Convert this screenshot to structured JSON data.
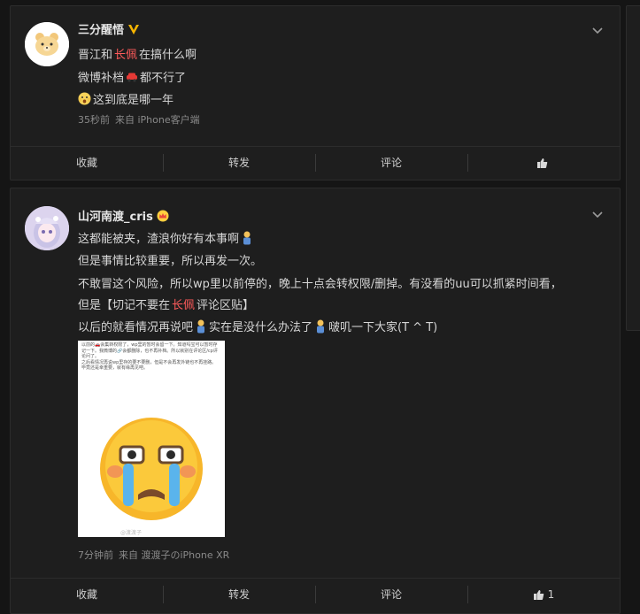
{
  "posts": [
    {
      "username": "三分醒悟",
      "badge": "verified-v-icon",
      "lines": {
        "l1_a": "晋江和",
        "l1_hl": "长佩",
        "l1_b": "在搞什么啊",
        "l2_a": "微博补档",
        "l2_b": "都不行了",
        "l3": "这到底是哪一年"
      },
      "meta": {
        "time": "35秒前",
        "source": "来自 iPhone客户端"
      },
      "actions": {
        "favorite": "收藏",
        "repost": "转发",
        "comment": "评论",
        "like": ""
      }
    },
    {
      "username": "山河南渡_cris",
      "badge": "crown-icon",
      "lines": {
        "l1": "这都能被夹，渣浪你好有本事啊",
        "l2": "但是事情比较重要，所以再发一次。",
        "l3": "不敢冒这个风险，所以wp里以前停的，晚上十点会转权限/删掉。有没看的uu可以抓紧时间看，",
        "l4_a": "但是【切记不要在",
        "l4_hl": "长佩",
        "l4_b": "评论区贴】",
        "l5_a": "以后的就看情况再说吧",
        "l5_b": "实在是没什么办法了",
        "l5_c": "啵叽一下大家(T ^ T)"
      },
      "image_text": {
        "p1": "以前的🚗会集转权限了，wp里的暂时会留一下。知道吗宝可以暂时存记一下。我微博的🔗会都删除，也不再补档。所以就别在评论区/cp评论问了。",
        "p2": "之后看情况再说wp里存的要不要删，但是不会再发外链也不再挂路。",
        "p3": "毕竟还是幸重要，就有缘再见吧。",
        "watermark": "@渡渡子"
      },
      "meta": {
        "time": "7分钟前",
        "source": "来自 渡渡子のiPhone XR"
      },
      "actions": {
        "favorite": "收藏",
        "repost": "转发",
        "comment": "评论",
        "like": "1"
      }
    }
  ],
  "colors": {
    "highlight": "#ff5b5b",
    "background": "#151515",
    "card": "#1e1e1e"
  }
}
